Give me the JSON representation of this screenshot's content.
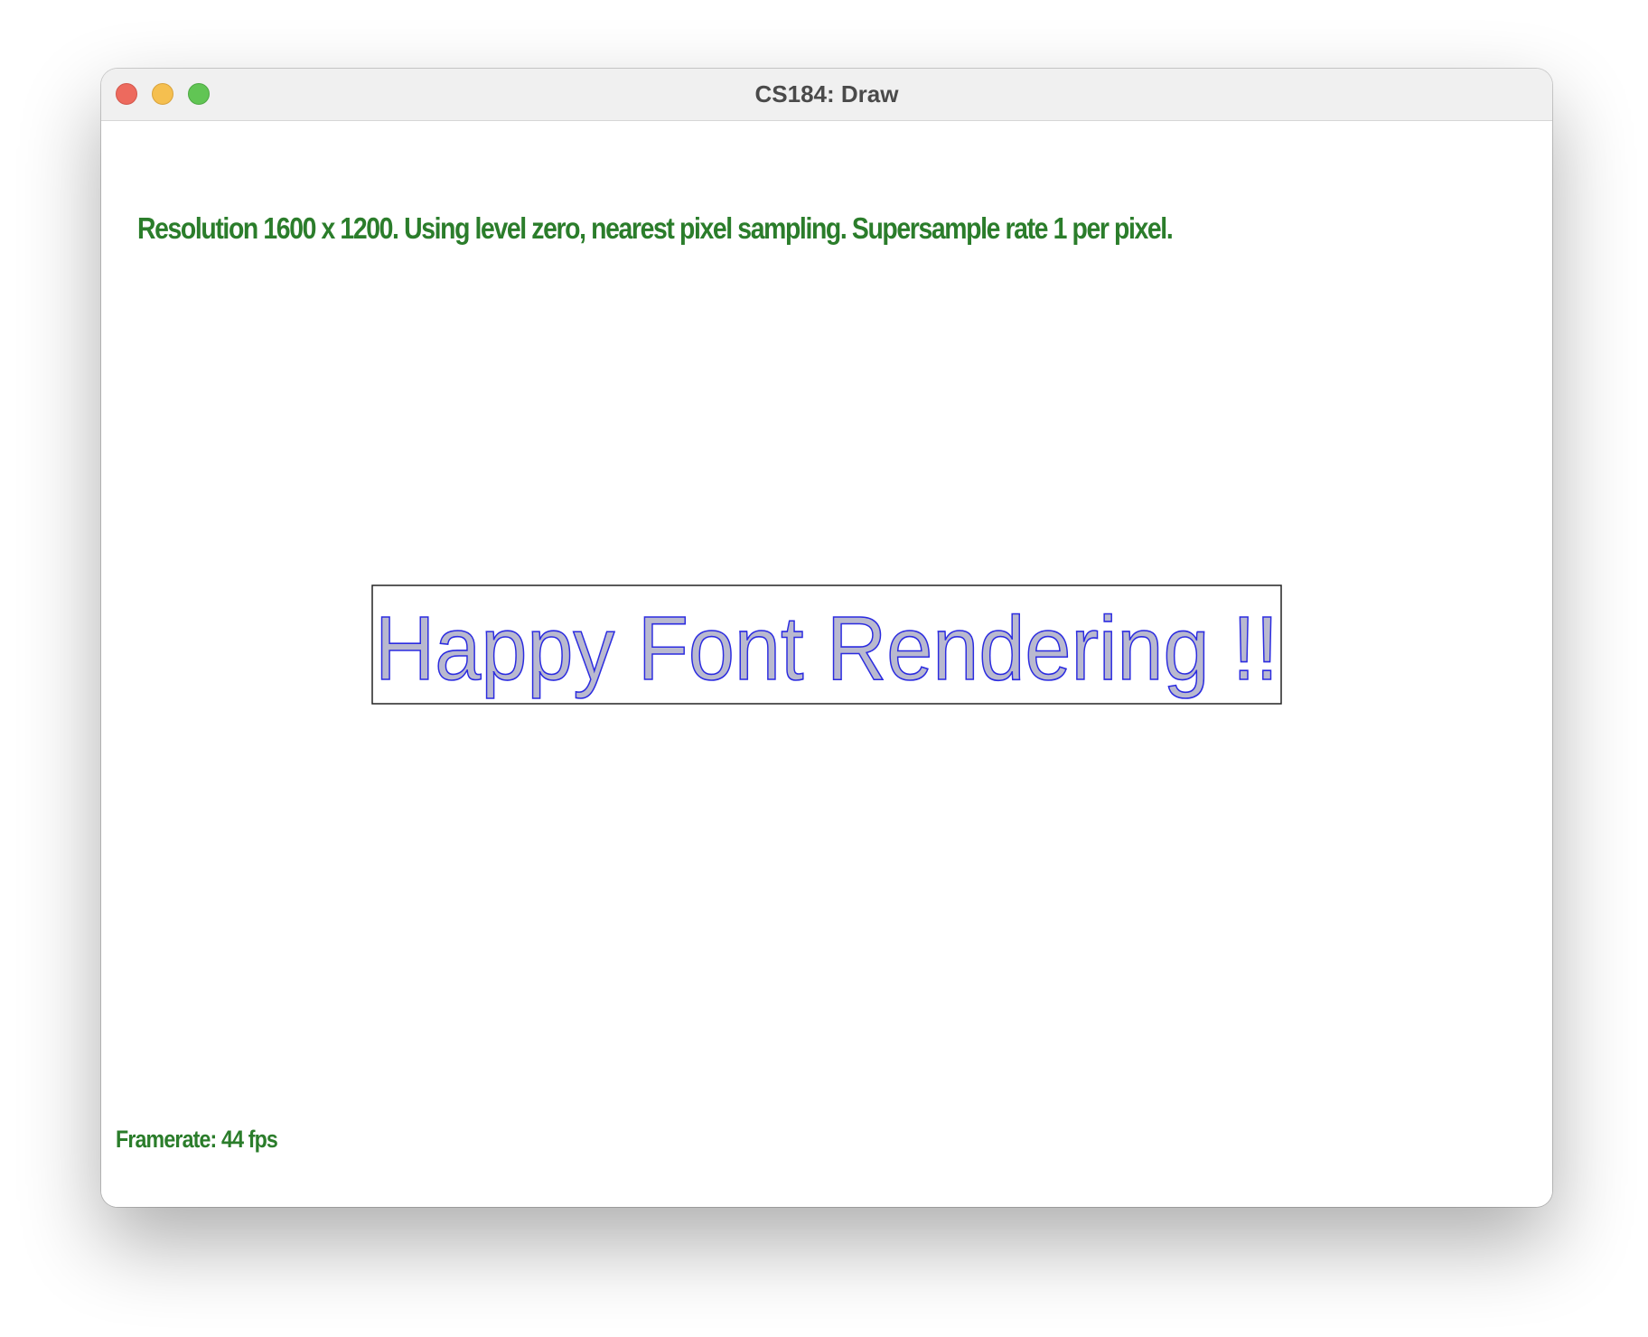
{
  "window": {
    "title": "CS184: Draw"
  },
  "status": {
    "info": "Resolution 1600 x 1200. Using level zero, nearest pixel sampling. Supersample rate 1 per pixel.",
    "framerate": "Framerate: 44 fps"
  },
  "canvas": {
    "rendered_text": "Happy Font Rendering !!",
    "text_fill_color": "#b9b9cf",
    "text_outline_color": "#2b2be0",
    "box_border_color": "#222222"
  },
  "colors": {
    "status_text": "#2b7d2b",
    "close": "#ed6a5e",
    "minimize": "#f5bf4f",
    "zoom": "#61c554"
  },
  "icons": {
    "close": "close-circle",
    "minimize": "minimize-circle",
    "zoom": "zoom-circle"
  }
}
